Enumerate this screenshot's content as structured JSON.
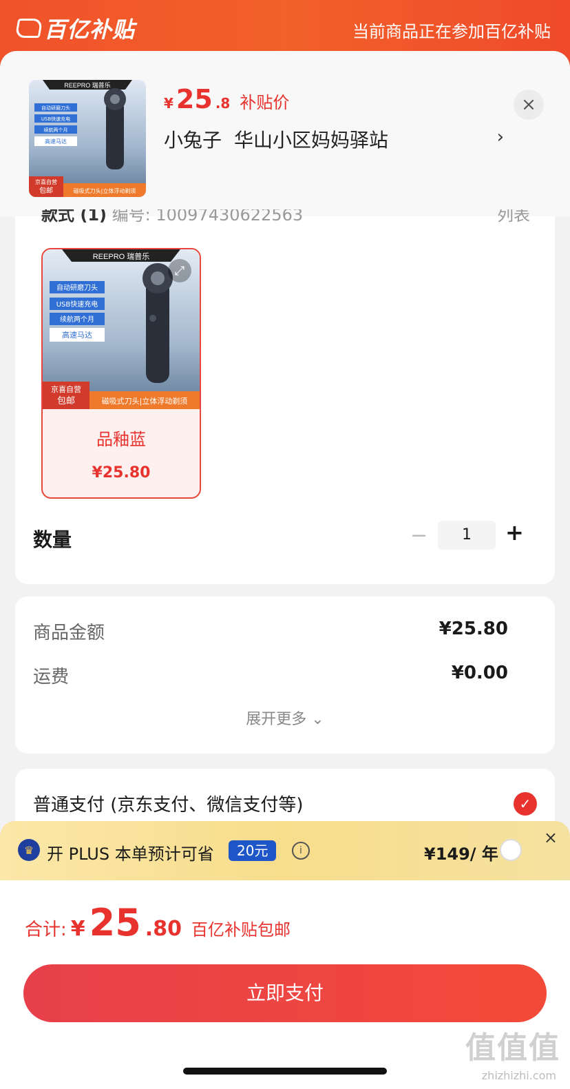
{
  "banner": {
    "brand": "百亿补贴",
    "notice": "当前商品正在参加百亿补贴"
  },
  "product": {
    "brand_logo": "REEPRO 瑞普乐",
    "features": [
      "自动研磨刀头",
      "USB快速充电",
      "续航两个月",
      "高速马达"
    ],
    "badge_top": "京喜自营",
    "badge_bottom": "包邮",
    "footer_strip": "磁吸式刀头|立体浮动剃须",
    "price_currency": "¥",
    "price_int": "25",
    "price_dec": ".8",
    "price_tag": "补贴价",
    "address_name": "小兔子",
    "address_location": "华山小区妈妈驿站",
    "address_chevron": "›",
    "close": "×"
  },
  "style": {
    "header_label": "款式 (1)",
    "header_code": "编号: 100974306225​63",
    "list_toggle": "列表",
    "variant_name": "品釉蓝",
    "variant_price": "¥25.80",
    "qty_label": "数量",
    "qty_minus": "−",
    "qty_value": "1",
    "qty_plus": "+"
  },
  "summary": {
    "goods_label": "商品金额",
    "goods_value": "¥25.80",
    "shipping_label": "运费",
    "shipping_value": "¥0.00",
    "expand_more": "展开更多 ⌄"
  },
  "payment": {
    "method": "普通支付 (京东支付、微信支付等)",
    "check": "✓"
  },
  "plus": {
    "text": "开 PLUS 本单预计可省",
    "save": "20元",
    "info": "i",
    "price": "¥149/ 年",
    "close": "×"
  },
  "total": {
    "label": "合计:",
    "currency": "¥",
    "int": "25",
    "dec": ".80",
    "note": "百亿补贴包邮",
    "pay_button": "立即支付"
  },
  "watermark": {
    "mark": "值值值",
    "url": "zhizhizhi.com"
  },
  "colors": {
    "brand_red": "#e8322d",
    "banner_orange": "#f0522a",
    "plus_gold": "#f7dd8c",
    "plus_blue": "#1f56c7"
  }
}
